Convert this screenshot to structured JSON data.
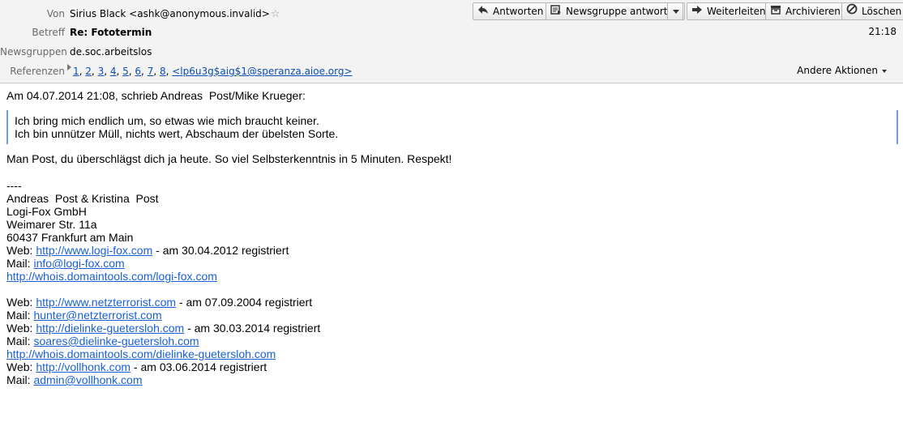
{
  "header": {
    "from_label": "Von",
    "from_value": "Sirius Black <ashk@anonymous.invalid>",
    "subject_label": "Betreff",
    "subject_value": "Re: Fototermin",
    "newsgroups_label": "Newsgruppen",
    "newsgroups_value": "de.soc.arbeitslos",
    "references_label": "Referenzen",
    "references": [
      "1",
      "2",
      "3",
      "4",
      "5",
      "6",
      "7",
      "8",
      "<lp6u3g$aig$1@speranza.aioe.org>"
    ],
    "time": "21:18",
    "other_actions": "Andere Aktionen"
  },
  "toolbar": {
    "reply": "Antworten",
    "reply_newsgroup": "Newsgruppe antworten",
    "forward": "Weiterleiten",
    "archive": "Archivieren",
    "delete": "Löschen"
  },
  "body": {
    "intro": "Am 04.07.2014 21:08, schrieb Andreas  Post/Mike Krueger:",
    "quote": [
      "Ich bring mich endlich um, so etwas wie mich braucht keiner.",
      "Ich bin unnützer Müll, nichts wert, Abschaum der übelsten Sorte."
    ],
    "reply": "Man Post, du überschlägst dich ja heute. So viel Selbsterkenntnis in 5 Minuten. Respekt!",
    "sig_sep": "----",
    "sig_name": "Andreas  Post & Kristina  Post",
    "sig_company": "Logi-Fox GmbH",
    "sig_street": "Weimarer Str. 11a",
    "sig_city": "60437 Frankfurt am Main",
    "web_label": "Web: ",
    "mail_label": "Mail: ",
    "registered_1": " - am 30.04.2012 registriert",
    "link_web_1": "http://www.logi-fox.com",
    "link_mail_1": "info@logi-fox.com",
    "link_whois_1": "http://whois.domaintools.com/logi-fox.com",
    "link_web_2": "http://www.netzterrorist.com",
    "registered_2": " - am 07.09.2004 registriert",
    "link_mail_2": "hunter@netzterrorist.com",
    "link_web_3": "http://dielinke-guetersloh.com",
    "registered_3": " - am 30.03.2014 registriert",
    "link_mail_3": "soares@dielinke-guetersloh.com",
    "link_whois_3": "http://whois.domaintools.com/dielinke-guetersloh.com",
    "link_web_4": "http://vollhonk.com",
    "registered_4": " - am 03.06.2014 registriert",
    "link_mail_4": "admin@vollhonk.com"
  },
  "icons": [
    "reply-icon",
    "newsgroup-reply-icon",
    "forward-icon",
    "archive-icon",
    "delete-icon",
    "star-icon"
  ]
}
